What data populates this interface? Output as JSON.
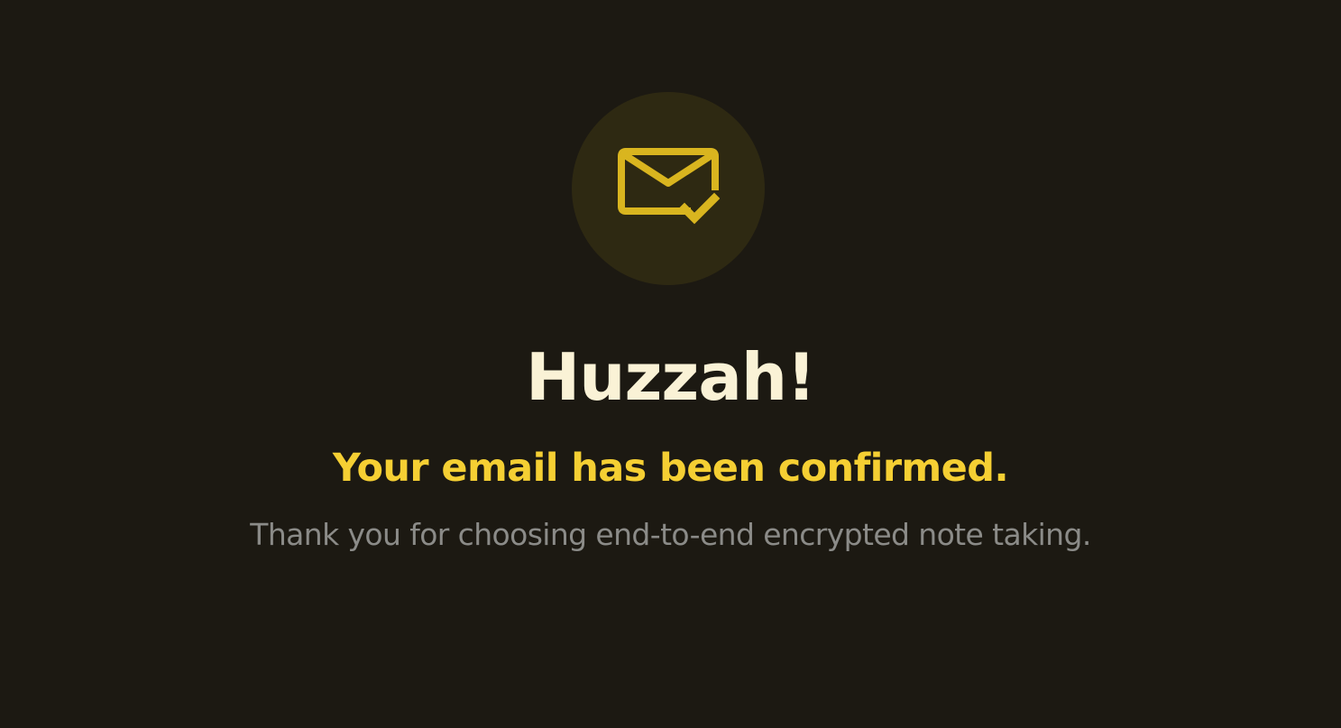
{
  "confirmation": {
    "icon": "mail-check-icon",
    "heading": "Huzzah!",
    "message": "Your email has been confirmed.",
    "thank_you": "Thank you for choosing end-to-end encrypted note taking."
  },
  "colors": {
    "background": "#1c1912",
    "icon_circle": "#2e2912",
    "icon": "#d9b51f",
    "heading": "#faf2d6",
    "message": "#f5cf33",
    "thank_you": "#8b8b88"
  }
}
